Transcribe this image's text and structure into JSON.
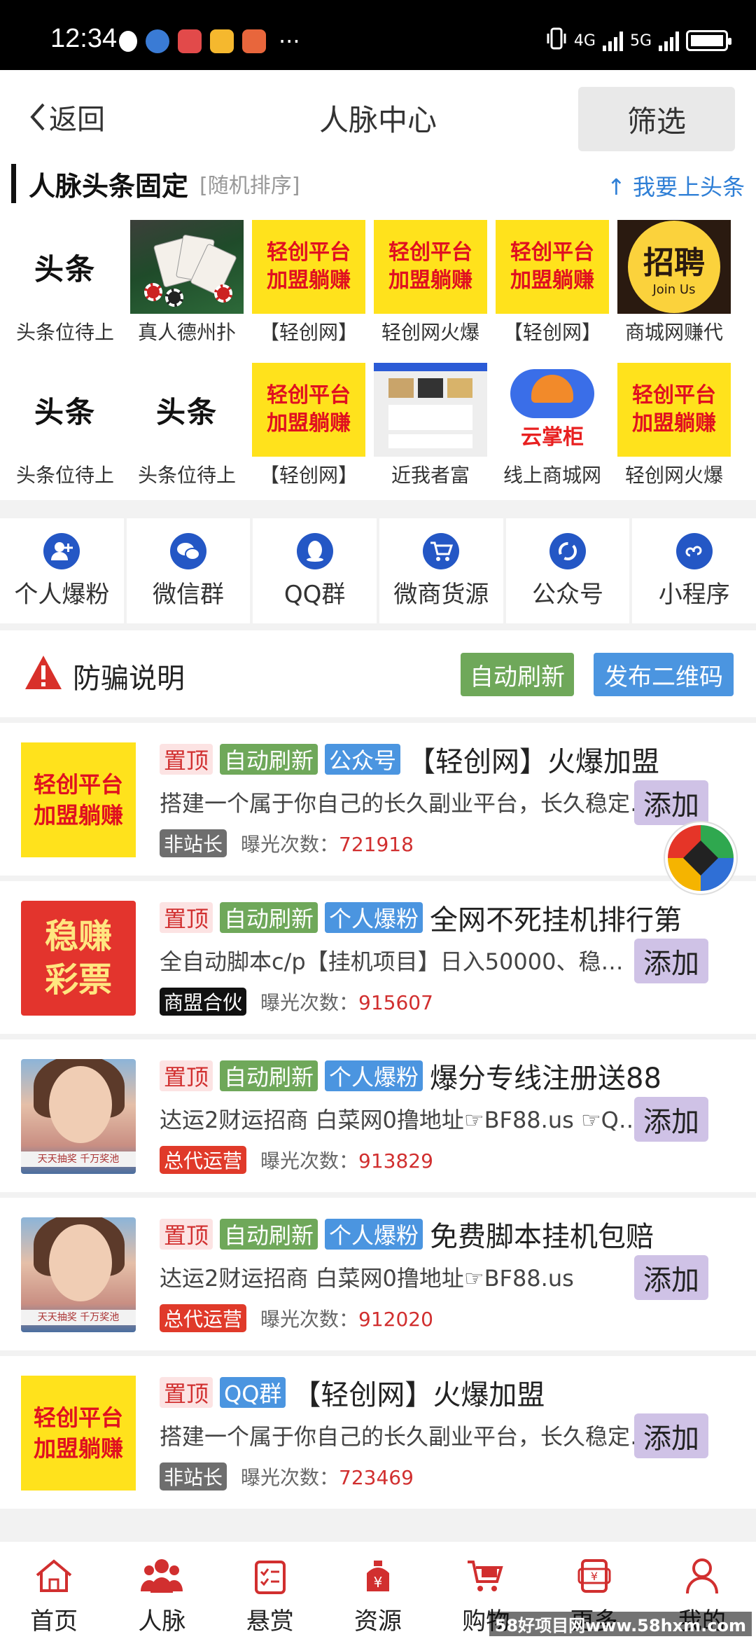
{
  "status_bar": {
    "time": "12:34",
    "more": "···",
    "net1": "4G",
    "net2": "5G"
  },
  "header": {
    "back_label": "返回",
    "title": "人脉中心",
    "filter_label": "筛选"
  },
  "headlines": {
    "title": "人脉头条固定",
    "subtitle": "[随机排序]",
    "link": "↑ 我要上头条",
    "img_text": {
      "toutiao": "头条",
      "qc_line1": "轻创平台",
      "qc_line2": "加盟躺赚",
      "zp_big": "招聘",
      "zp_small": "Join Us",
      "yzg": "云掌柜"
    },
    "row1": [
      {
        "img": "toutiao",
        "caption": "头条位待上"
      },
      {
        "img": "poker",
        "caption": "真人德州扑"
      },
      {
        "img": "qc",
        "caption": "【轻创网】"
      },
      {
        "img": "qc",
        "caption": "轻创网火爆"
      },
      {
        "img": "qc",
        "caption": "【轻创网】"
      },
      {
        "img": "zp",
        "caption": "商城网赚代"
      }
    ],
    "row2": [
      {
        "img": "toutiao",
        "caption": "头条位待上"
      },
      {
        "img": "toutiao",
        "caption": "头条位待上"
      },
      {
        "img": "qc",
        "caption": "【轻创网】"
      },
      {
        "img": "app",
        "caption": "近我者富"
      },
      {
        "img": "yzg",
        "caption": "线上商城网"
      },
      {
        "img": "qc",
        "caption": "轻创网火爆"
      }
    ]
  },
  "categories": [
    {
      "label": "个人爆粉",
      "icon": "add-user-icon"
    },
    {
      "label": "微信群",
      "icon": "wechat-icon"
    },
    {
      "label": "QQ群",
      "icon": "qq-icon"
    },
    {
      "label": "微商货源",
      "icon": "cart-icon"
    },
    {
      "label": "公众号",
      "icon": "official-account-icon"
    },
    {
      "label": "小程序",
      "icon": "mini-program-icon"
    }
  ],
  "notice": {
    "title": "防骗说明",
    "refresh_btn": "自动刷新",
    "qr_btn": "发布二维码"
  },
  "listings": [
    {
      "thumb": "qc",
      "tags": [
        "置顶",
        "自动刷新",
        "公众号"
      ],
      "title": "【轻创网】火爆加盟",
      "desc": "搭建一个属于你自己的长久副业平台，长久稳定…",
      "badge": "非站长",
      "badge_style": "gray",
      "views_label": "曝光次数：",
      "views": "721918",
      "add": "添加"
    },
    {
      "thumb": "wz",
      "tags": [
        "置顶",
        "自动刷新",
        "个人爆粉"
      ],
      "title": "全网不死挂机排行第",
      "desc": "全自动脚本c/p【挂机项目】日入50000、稳…",
      "badge": "商盟合伙",
      "badge_style": "black",
      "views_label": "曝光次数：",
      "views": "915607",
      "add": "添加"
    },
    {
      "thumb": "girl",
      "tags": [
        "置顶",
        "自动刷新",
        "个人爆粉"
      ],
      "title": "爆分专线注册送88",
      "desc": "达运2财运招商 白菜网0撸地址☞BF88.us ☞Q…",
      "badge": "总代运营",
      "badge_style": "red",
      "views_label": "曝光次数：",
      "views": "913829",
      "add": "添加"
    },
    {
      "thumb": "girl",
      "tags": [
        "置顶",
        "自动刷新",
        "个人爆粉"
      ],
      "title": "免费脚本挂机包赔",
      "desc": "达运2财运招商 白菜网0撸地址☞BF88.us",
      "badge": "总代运营",
      "badge_style": "red",
      "views_label": "曝光次数：",
      "views": "912020",
      "add": "添加"
    },
    {
      "thumb": "qc",
      "tags": [
        "置顶",
        "QQ群"
      ],
      "title": "【轻创网】火爆加盟",
      "desc": "搭建一个属于你自己的长久副业平台，长久稳定…",
      "badge": "非站长",
      "badge_style": "gray",
      "views_label": "曝光次数：",
      "views": "723469",
      "add": "添加"
    }
  ],
  "thumb_text": {
    "qc_line1": "轻创平台",
    "qc_line2": "加盟躺赚",
    "wz_line1": "稳赚",
    "wz_line2": "彩票",
    "girl_band": "天天抽奖 千万奖池"
  },
  "bottom_nav": [
    {
      "label": "首页",
      "icon": "home-icon"
    },
    {
      "label": "人脉",
      "icon": "contacts-icon"
    },
    {
      "label": "悬赏",
      "icon": "reward-icon"
    },
    {
      "label": "资源",
      "icon": "resource-icon"
    },
    {
      "label": "购物",
      "icon": "shopping-icon"
    },
    {
      "label": "更多",
      "icon": "more-icon"
    },
    {
      "label": "我的",
      "icon": "profile-icon"
    }
  ],
  "watermark": "58好项目网www.58hxm.com",
  "colors": {
    "accent_red": "#d12f2f",
    "tag_green": "#6fa85a",
    "tag_blue": "#4b95e0",
    "add_purple": "#cfc2e6",
    "brand_yellow": "#ffe21c"
  }
}
